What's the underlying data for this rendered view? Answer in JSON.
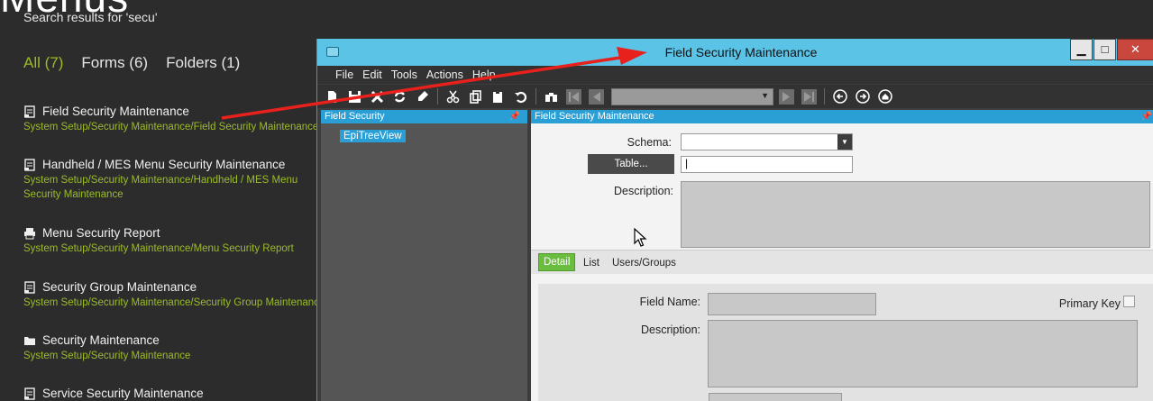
{
  "page": {
    "title": "Menus",
    "subtitle": "Search results for 'secu'"
  },
  "filters": [
    {
      "label": "All (7)",
      "active": true
    },
    {
      "label": "Forms (6)",
      "active": false
    },
    {
      "label": "Folders (1)",
      "active": false
    }
  ],
  "results": [
    {
      "title": "Field Security Maintenance",
      "path": "System Setup/Security Maintenance/Field Security Maintenance",
      "icon": "form-icon"
    },
    {
      "title": "Handheld / MES Menu Security Maintenance",
      "path": "System Setup/Security Maintenance/Handheld / MES Menu Security Maintenance",
      "icon": "form-icon"
    },
    {
      "title": "Menu Security Report",
      "path": "System Setup/Security Maintenance/Menu Security Report",
      "icon": "printer-icon"
    },
    {
      "title": "Security Group Maintenance",
      "path": "System Setup/Security Maintenance/Security Group Maintenance",
      "icon": "form-icon"
    },
    {
      "title": "Security Maintenance",
      "path": "System Setup/Security Maintenance",
      "icon": "folder-icon"
    },
    {
      "title": "Service Security Maintenance",
      "path": "",
      "icon": "form-icon"
    }
  ],
  "window": {
    "title": "Field Security Maintenance",
    "buttons": {
      "minimize": "▁",
      "maximize": "□",
      "close": "✕"
    },
    "menu": [
      "File",
      "Edit",
      "Tools",
      "Actions",
      "Help"
    ],
    "tree_panel": {
      "title": "Field Security",
      "node": "EpiTreeView"
    },
    "detail_panel": {
      "title": "Field Security Maintenance",
      "schema_label": "Schema:",
      "table_button": "Table...",
      "description_label": "Description:",
      "tabs": [
        "Detail",
        "List",
        "Users/Groups"
      ],
      "field_name_label": "Field Name:",
      "primary_key_label": "Primary Key",
      "detail_description_label": "Description:"
    }
  },
  "colors": {
    "accent": "#2a9fd6",
    "titlebar": "#5ac3e6",
    "green": "#9bbb2a",
    "arrow": "#e8211c"
  }
}
